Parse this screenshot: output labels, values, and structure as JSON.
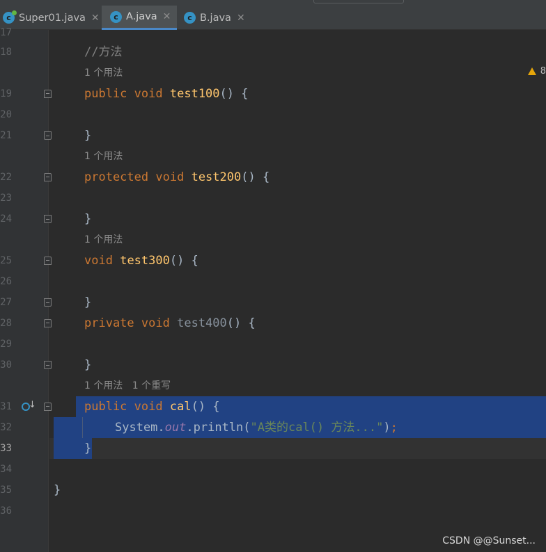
{
  "tabs": [
    {
      "label": "Super01.java",
      "icon": "class-icon-with-main",
      "close": "✕"
    },
    {
      "label": "A.java",
      "icon": "class-icon",
      "close": "✕",
      "active": true
    },
    {
      "label": "B.java",
      "icon": "class-icon",
      "close": "✕"
    }
  ],
  "tab_icon_letter": "c",
  "warnings": {
    "count": "8"
  },
  "line_numbers": [
    "17",
    "18",
    "19",
    "20",
    "21",
    "22",
    "23",
    "24",
    "25",
    "26",
    "27",
    "28",
    "29",
    "30",
    "31",
    "32",
    "33",
    "34",
    "35",
    "36"
  ],
  "hints": {
    "usage1": "1 个用法",
    "usage2": "1 个用法",
    "usage3": "1 个用法",
    "usage4": "1 个用法",
    "override4": "1 个重写"
  },
  "code": {
    "comment": "//方法",
    "l19": {
      "mod": "public",
      "type": "void",
      "name": "test100",
      "rest": "() {"
    },
    "l21": "}",
    "l22": {
      "mod": "protected",
      "type": "void",
      "name": "test200",
      "rest": "() {"
    },
    "l24": "}",
    "l25": {
      "type": "void",
      "name": "test300",
      "rest": "() {"
    },
    "l27": "}",
    "l28": {
      "mod": "private",
      "type": "void",
      "name": "test400",
      "rest": "() {"
    },
    "l30": "}",
    "l31": {
      "mod": "public",
      "type": "void",
      "name": "cal",
      "rest": "() {"
    },
    "l32": {
      "obj": "System.",
      "field": "out",
      "call": ".println(",
      "str": "\"A类的cal() 方法...\"",
      "end": ")",
      "semi": ";"
    },
    "l33": "}",
    "l35": "}"
  },
  "watermark": "CSDN @@Sunset...",
  "colors": {
    "background": "#2b2b2b",
    "keyword": "#cc7832",
    "method": "#ffc66d",
    "string": "#6a8759",
    "selection": "#214283",
    "tab_underline": "#4a88c7"
  }
}
